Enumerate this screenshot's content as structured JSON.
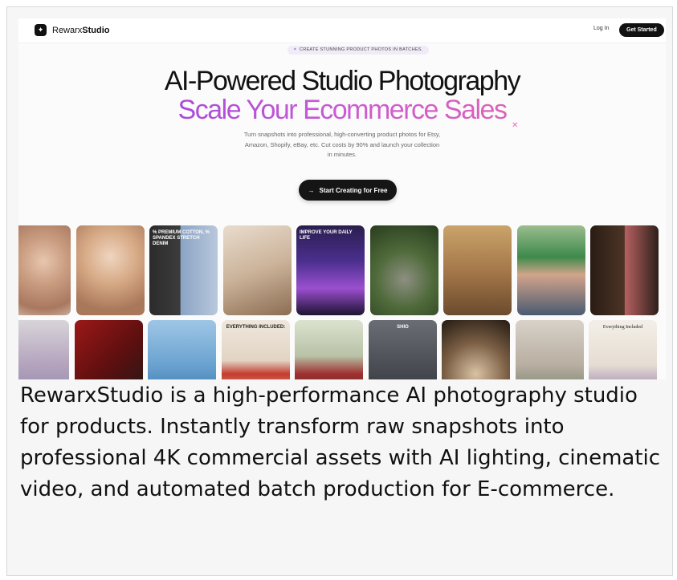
{
  "nav": {
    "brand_prefix": "Rewarx",
    "brand_bold": "Studio",
    "logo_icon": "sparkle-logo",
    "login_label": "Log In",
    "get_started_label": "Get Started"
  },
  "hero": {
    "eyebrow": "CREATE STUNNING PRODUCT PHOTOS IN BATCHES.",
    "headline": "AI-Powered Studio Photography",
    "headline_accent": "Scale Your Ecommerce Sales",
    "subtitle": "Turn snapshots into professional, high-converting product photos for Etsy, Amazon, Shopify, eBay, etc. Cut costs by 90% and launch your collection in minutes.",
    "cta_label": "Start Creating for Free",
    "cta_icon": "arrow-right-icon",
    "accent_color": "#9d4fe6"
  },
  "gallery": {
    "row1": [
      {
        "label": "portrait-woman",
        "caption": ""
      },
      {
        "label": "woman-necklace",
        "caption": ""
      },
      {
        "label": "denim-jeans",
        "caption": "% PREMIUM COTTON, % SPANDEX STRETCH DENIM"
      },
      {
        "label": "makeup-brush",
        "caption": ""
      },
      {
        "label": "camera-gimbal",
        "caption": "IMPROVE YOUR DAILY LIFE"
      },
      {
        "label": "vintage-camera",
        "caption": ""
      },
      {
        "label": "coffee-grinder",
        "caption": ""
      },
      {
        "label": "man-green-cap",
        "caption": ""
      },
      {
        "label": "lipstick",
        "caption": ""
      }
    ],
    "row2": [
      {
        "label": "woman-field",
        "caption": ""
      },
      {
        "label": "woman-red-lipstick",
        "caption": ""
      },
      {
        "label": "perfume-bottle",
        "caption": ""
      },
      {
        "label": "red-handbag",
        "caption": "EVERYTHING INCLUDED:"
      },
      {
        "label": "woman-plaid",
        "caption": ""
      },
      {
        "label": "business-portraits",
        "caption": "SHIO"
      },
      {
        "label": "running-shoe",
        "caption": ""
      },
      {
        "label": "man-jar",
        "caption": ""
      },
      {
        "label": "amethyst-bracelet",
        "caption": "Everything Included"
      }
    ]
  },
  "description": "RewarxStudio is a high-performance AI photography studio for products. Instantly transform raw snapshots into professional 4K commercial assets with AI lighting, cinematic video, and automated batch production for E-commerce."
}
